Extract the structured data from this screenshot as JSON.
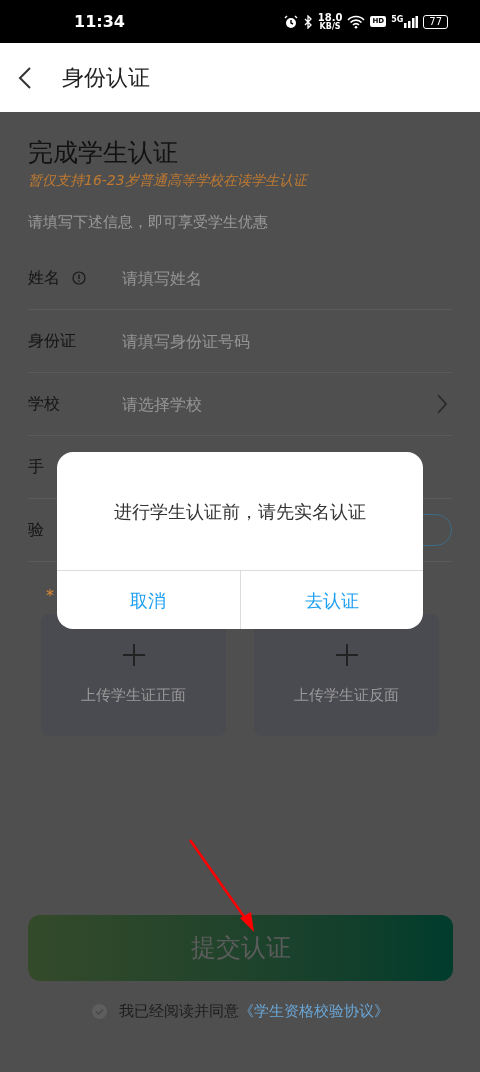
{
  "status_bar": {
    "time": "11:34",
    "net_speed": "18.0",
    "net_unit": "KB/S",
    "hd": "HD",
    "network": "5G",
    "battery": "77"
  },
  "header": {
    "title": "身份认证"
  },
  "page": {
    "title": "完成学生认证",
    "notice": "暂仅支持16-23岁普通高等学校在读学生认证",
    "hint": "请填写下述信息，即可享受学生优惠",
    "fields": [
      {
        "kind": "input",
        "label": "姓名",
        "info": true,
        "placeholder": "请填写姓名"
      },
      {
        "kind": "input",
        "label": "身份证",
        "info": false,
        "placeholder": "请填写身份证号码"
      },
      {
        "kind": "select",
        "label": "学校",
        "placeholder": "请选择学校"
      },
      {
        "kind": "input",
        "label": "手"
      },
      {
        "kind": "code",
        "label": "验"
      }
    ],
    "required_mark": "*",
    "uploads": [
      "上传学生证正面",
      "上传学生证反面"
    ],
    "submit": "提交认证",
    "agreement": {
      "checked": true,
      "text": "我已经阅读并同意",
      "link": "《学生资格校验协议》"
    }
  },
  "dialog": {
    "message": "进行学生认证前，请先实名认证",
    "buttons": [
      "取消",
      "去认证"
    ]
  }
}
